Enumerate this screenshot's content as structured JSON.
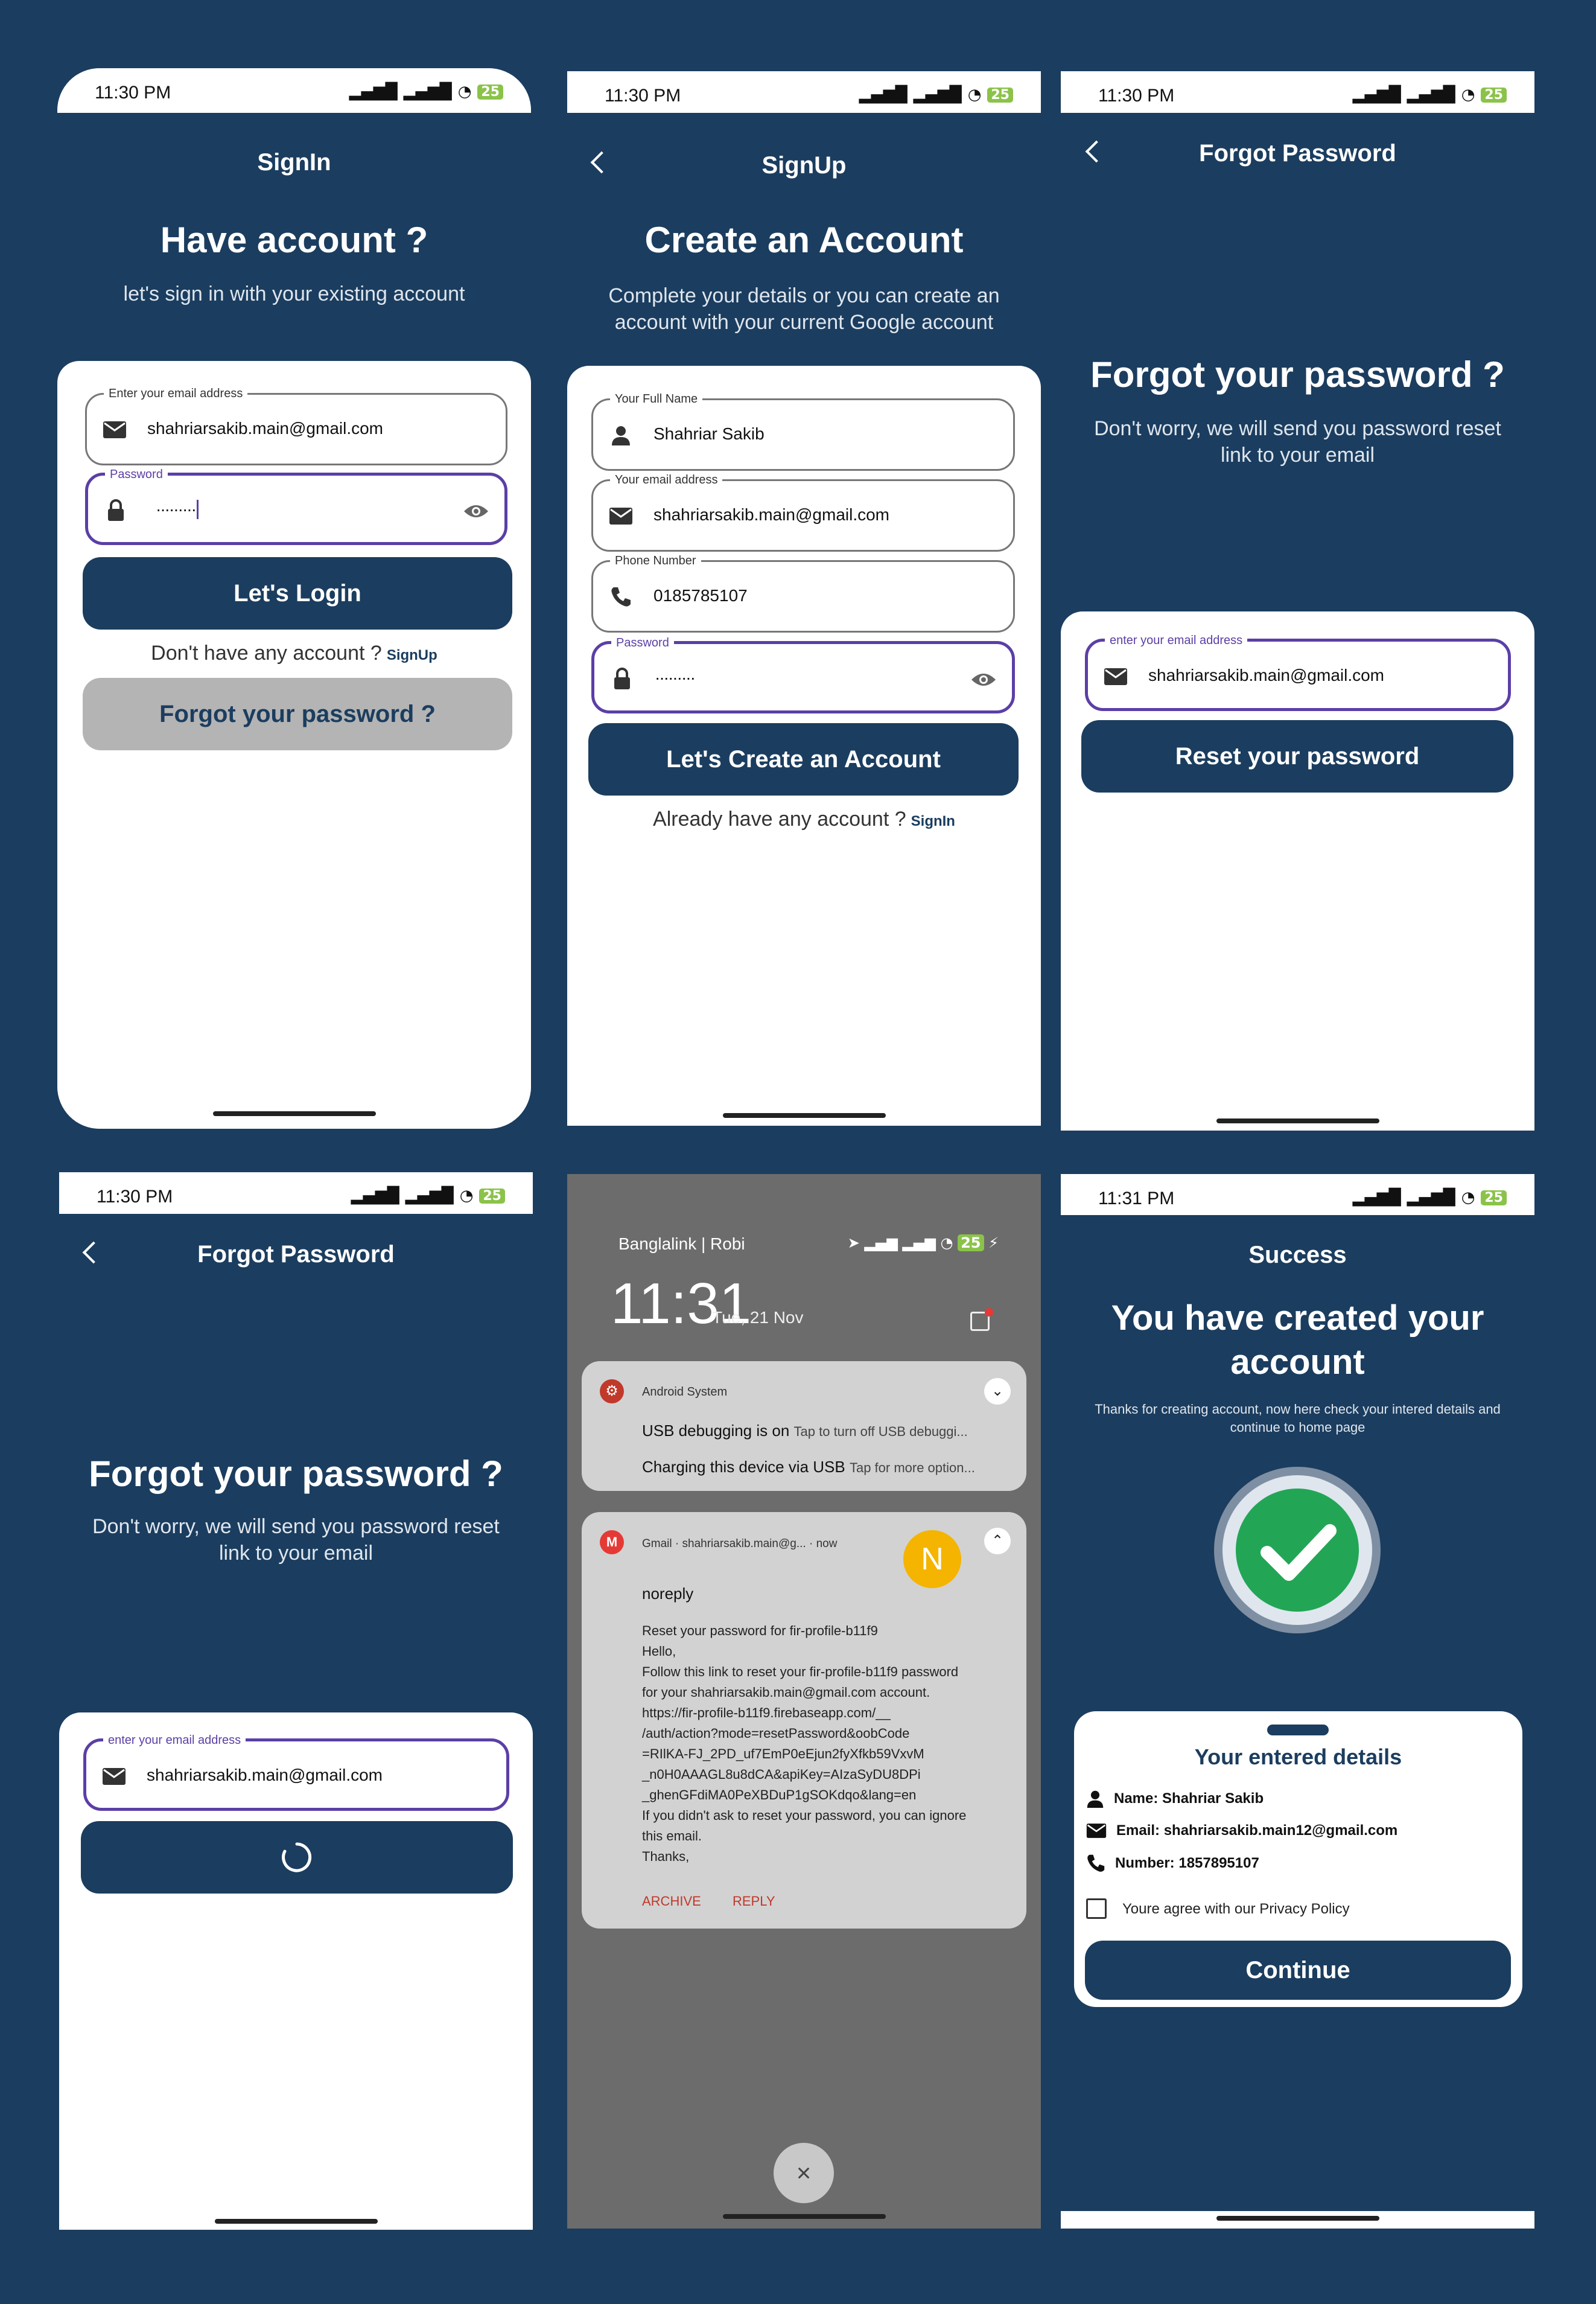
{
  "status": {
    "time": "11:30 PM",
    "battery": "25"
  },
  "signin": {
    "header": "SignIn",
    "title": "Have account ?",
    "subtitle": "let's sign in with your existing account",
    "email_label": "Enter your email address",
    "email_value": "shahriarsakib.main@gmail.com",
    "password_label": "Password",
    "password_value": "·········",
    "login_button": "Let's Login",
    "no_account": "Don't  have any account ?",
    "signup_link": "SignUp",
    "forgot_button": "Forgot your password ?"
  },
  "signup": {
    "header": "SignUp",
    "title": "Create an Account",
    "subtitle": "Complete your details or you can create an account with your current Google account",
    "name_label": "Your Full Name",
    "name_value": "Shahriar Sakib",
    "email_label": "Your email address",
    "email_value": "shahriarsakib.main@gmail.com",
    "phone_label": "Phone Number",
    "phone_value": "0185785107",
    "password_label": "Password",
    "password_value": "·········",
    "create_button": "Let's Create an Account",
    "have_account": "Already have any account ?",
    "signin_link": "SignIn"
  },
  "forgot": {
    "header": "Forgot Password",
    "title": "Forgot your password ?",
    "subtitle": "Don't worry, we will send you password reset link to your email",
    "email_label": "enter your email address",
    "email_value": "shahriarsakib.main@gmail.com",
    "reset_button": "Reset your password"
  },
  "notifications": {
    "carrier": "Banglalink | Robi",
    "clock": "11:31",
    "date": "Tue, 21 Nov",
    "battery": "25",
    "system_app": "Android System",
    "usb_title": "USB debugging is on",
    "usb_text": "Tap to turn off USB debuggi...",
    "charge_title": "Charging this device via USB",
    "charge_text": "Tap for more option...",
    "gmail_app": "Gmail",
    "gmail_account": "shahriarsakib.main@g...",
    "gmail_time": "now",
    "avatar_letter": "N",
    "sender": "noreply",
    "body": [
      "Reset your password for fir-profile-b11f9",
      "Hello,",
      "Follow this link to reset your fir-profile-b11f9 password",
      "for your shahriarsakib.main@gmail.com account.",
      "https://fir-profile-b11f9.firebaseapp.com/__",
      "/auth/action?mode=resetPassword&oobCode",
      "=RIlKA-FJ_2PD_uf7EmP0eEjun2fyXfkb59VxvM",
      "_n0H0AAAGL8u8dCA&apiKey=AIzaSyDU8DPi",
      "_ghenGFdiMA0PeXBDuP1gSOKdqo&lang=en",
      "If you didn't ask to reset your password, you can ignore",
      "this email.",
      "Thanks,"
    ],
    "archive": "ARCHIVE",
    "reply": "REPLY"
  },
  "success": {
    "time": "11:31 PM",
    "header": "Success",
    "title_line1": "You have created your",
    "title_line2": "account",
    "subtitle": "Thanks for creating account, now here check your intered details and continue to home page",
    "details_title": "Your entered details",
    "name": "Name: Shahriar Sakib",
    "email": "Email: shahriarsakib.main12@gmail.com",
    "number": "Number: 1857895107",
    "privacy": "Youre agree with our Privacy Policy",
    "continue_button": "Continue"
  },
  "colors": {
    "primary": "#1b3d5f",
    "focus": "#5b3fa6",
    "success": "#22a656"
  }
}
